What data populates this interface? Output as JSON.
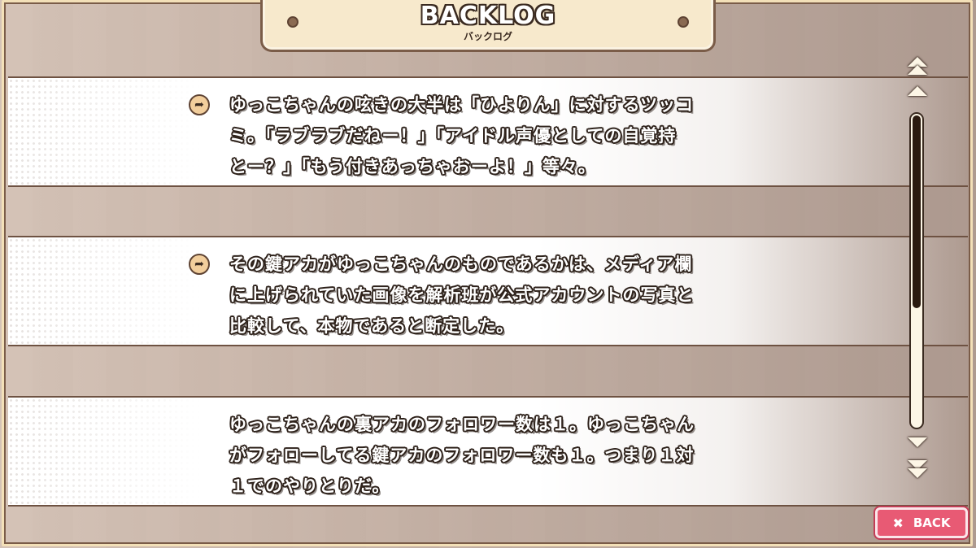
{
  "header": {
    "title": "BACKLOG",
    "subtitle": "バックログ"
  },
  "entries": [
    {
      "has_voice": true,
      "lines": [
        "ゆっこちゃんの呟きの大半は「ひよりん」に対するツッコ",
        "ミ。「ラブラブだねー！」「アイドル声優としての自覚持",
        "とー？」「もう付きあっちゃおーよ！」等々。"
      ]
    },
    {
      "has_voice": true,
      "lines": [
        "その鍵アカがゆっこちゃんのものであるかは、メディア欄",
        "に上げられていた画像を解析班が公式アカウントの写真と",
        "比較して、本物であると断定した。"
      ]
    },
    {
      "has_voice": false,
      "lines": [
        "ゆっこちゃんの裏アカのフォロワー数は１。ゆっこちゃん",
        "がフォローしてる鍵アカのフォロワー数も１。つまり１対",
        "１でのやりとりだ。"
      ]
    }
  ],
  "controls": {
    "back_label": "BACK",
    "back_icon": "close-icon",
    "voice_icon": "voice-replay-icon",
    "scroll_position": 0.62
  },
  "colors": {
    "frame": "#7a5c48",
    "tab_bg": "#f7e9cc",
    "back_button": "#e85a74"
  }
}
